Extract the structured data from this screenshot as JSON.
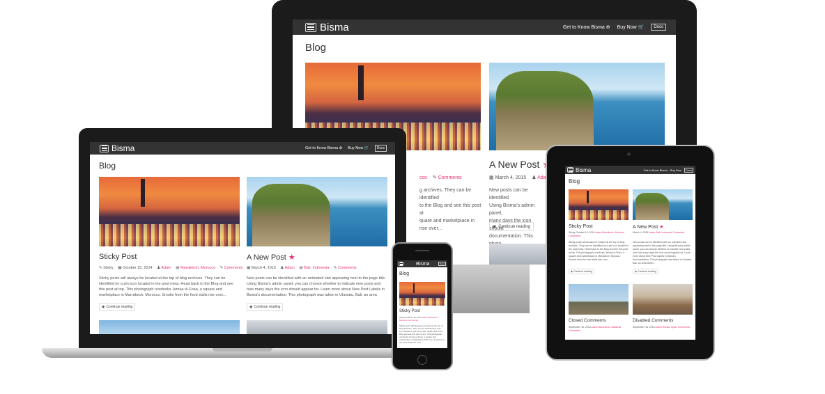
{
  "brand": "Bisma",
  "nav": {
    "about": "Get to Know Bisma",
    "about_icon": "⊕",
    "buy": "Buy Now",
    "buy_icon": "🛒",
    "docs": "Docs"
  },
  "page_title": "Blog",
  "posts": [
    {
      "title": "Sticky Post",
      "sticky_label": "Sticky",
      "date": "October 15, 2014",
      "author": "Adam",
      "category": "Marrakech, Morocco",
      "comments": "Comments",
      "excerpt": "Sticky posts will always be located at the top of blog archives. They can be identified by a pin icon located in the post meta. Head back to the Blog and see this post at top. This photograph overlooks Jemaa el-Fnaa, a square and marketplace in Marrakech, Morocco. Smoke from the food stalls rise over...",
      "button": "Continue reading"
    },
    {
      "title": "A New Post",
      "date": "March 4, 2015",
      "author": "Adam",
      "category": "Bali, Indonesia",
      "comments": "Comments",
      "excerpt": "New posts can be identified with an animated star appearing next to the page title. Using Bisma's admin panel, you can choose whether to indicate new posts and how many days the icon should appear for. Learn more about New Post Labels in Bisma's documentation. This photograph was taken in Uluwatu, Bali, an area which...",
      "button": "Continue reading"
    },
    {
      "title": "Closed Comments",
      "date": "September 16, 2014",
      "author": "Adam",
      "category": "Barcelona, Catalonia",
      "comments": "Comments"
    },
    {
      "title": "Disabled Comments",
      "date": "September 16, 2014",
      "author": "Adam",
      "category": "Ronda, Spain",
      "comments": "Comments"
    }
  ],
  "monitor_partial": {
    "category_tail": "cco",
    "excerpt_lines": [
      "g archives. They can be identified",
      "to the Blog and see this post at",
      "quare and marketplace in",
      "rise over..."
    ],
    "new_post_lines": [
      "New posts can be identified",
      "Using Bisma's admin panel,",
      "many days the icon should",
      "documentation. This photo"
    ]
  },
  "colors": {
    "accent": "#e8336d",
    "bar": "#333333"
  }
}
